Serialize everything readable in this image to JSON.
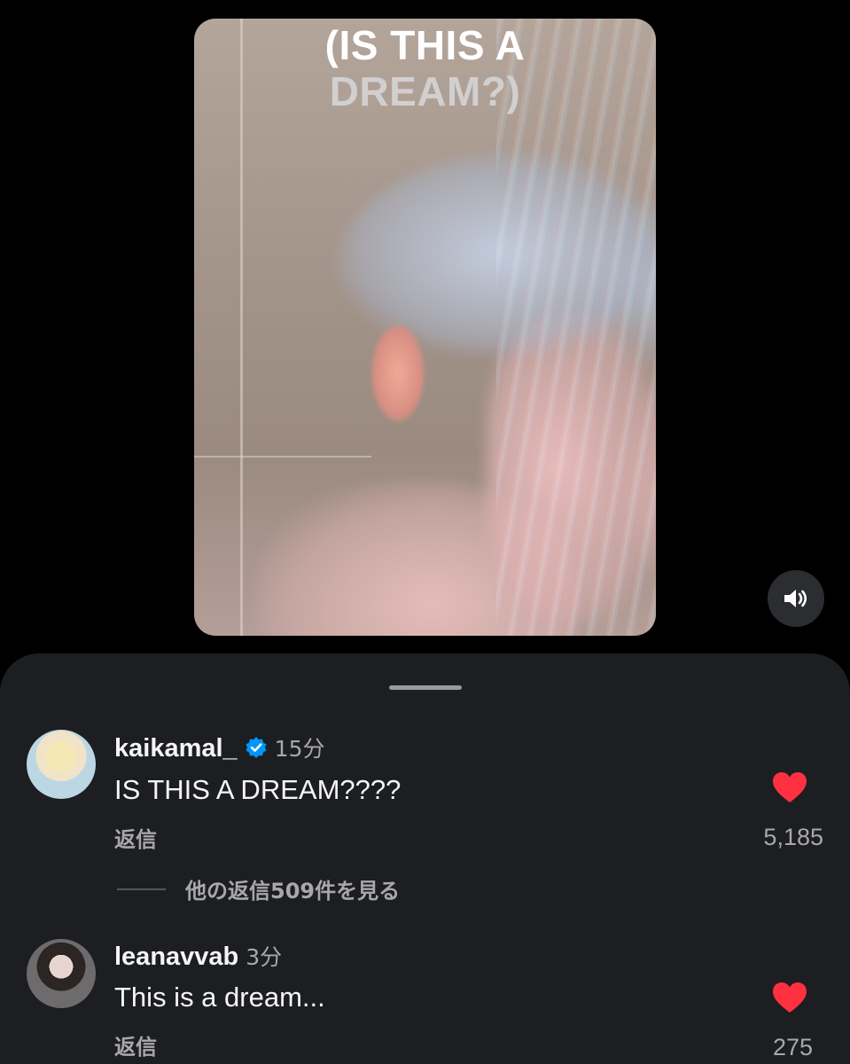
{
  "video": {
    "overlay_line1": "(IS THIS A",
    "overlay_line2": "DREAM?)",
    "sound_icon": "speaker-volume-icon"
  },
  "comments": [
    {
      "username": "kaikamal_",
      "verified": true,
      "time": "15分",
      "text": "IS THIS A DREAM????",
      "reply_label": "返信",
      "likes": "5,185",
      "view_replies": "他の返信509件を見る"
    },
    {
      "username": "leanavvab",
      "verified": false,
      "time": "3分",
      "text": "This is a dream...",
      "reply_label": "返信",
      "likes": "275"
    }
  ],
  "colors": {
    "background": "#000000",
    "sheet": "#1c1e21",
    "like_heart": "#ff3040",
    "verified_badge": "#0095f6",
    "secondary_text": "#a8a8a8"
  }
}
